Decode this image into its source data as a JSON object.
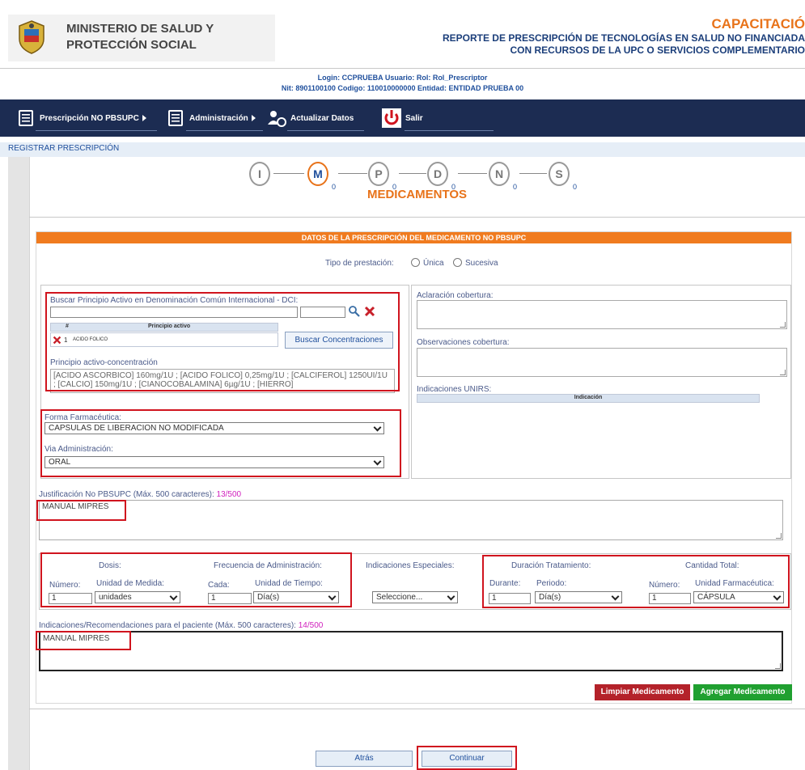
{
  "header": {
    "ministry_line1": "MINISTERIO DE SALUD Y",
    "ministry_line2": "PROTECCIÓN SOCIAL",
    "capacitacion": "CAPACITACIÓ",
    "report_line1": "REPORTE DE PRESCRIPCIÓN DE TECNOLOGÍAS EN SALUD NO FINANCIADA",
    "report_line2": "CON RECURSOS DE LA UPC O SERVICIOS COMPLEMENTARIO",
    "login_line1": "Login: CCPRUEBA Usuario: Rol: Rol_Prescriptor",
    "login_line2": "Nit: 8901100100 Codigo: 110010000000 Entidad: ENTIDAD PRUEBA 00"
  },
  "nav": {
    "items": [
      {
        "label": "Prescripción NO PBSUPC"
      },
      {
        "label": "Administración"
      },
      {
        "label": "Actualizar Datos"
      },
      {
        "label": "Salir"
      }
    ]
  },
  "section_title": "REGISTRAR PRESCRIPCIÓN",
  "steps": [
    {
      "letter": "I",
      "count": ""
    },
    {
      "letter": "M",
      "count": "0"
    },
    {
      "letter": "P",
      "count": "0"
    },
    {
      "letter": "D",
      "count": "0"
    },
    {
      "letter": "N",
      "count": "0"
    },
    {
      "letter": "S",
      "count": "0"
    }
  ],
  "step_title": "MEDICAMENTOS",
  "form": {
    "bar_title": "DATOS DE LA PRESCRIPCIÓN DEL MEDICAMENTO NO PBSUPC",
    "tipo_prestacion_label": "Tipo de prestación:",
    "tipo_unica": "Única",
    "tipo_sucesiva": "Sucesiva",
    "buscar_label": "Buscar Principio Activo en Denominación Común Internacional - DCI:",
    "table_hash": "#",
    "table_principio": "Principio activo",
    "row_num": "1",
    "row_value": "ACIDO FOLICO",
    "buscar_conc_btn": "Buscar Concentraciones",
    "principio_conc_label": "Principio activo-concentración",
    "principio_conc_value": "[ACIDO ASCORBICO] 160mg/1U ; [ACIDO FOLICO] 0,25mg/1U ; [CALCIFEROL] 1250UI/1U ; [CALCIO] 150mg/1U ; [CIANOCOBALAMINA] 6µg/1U ; [HIERRO]",
    "aclaracion_label": "Aclaración cobertura:",
    "observaciones_label": "Observaciones cobertura:",
    "indicaciones_unirs_label": "Indicaciones UNIRS:",
    "indicacion_col": "Indicación",
    "forma_label": "Forma Farmacéutica:",
    "forma_value": "CAPSULAS DE LIBERACION NO MODIFICADA",
    "via_label": "Via Administración:",
    "via_value": "ORAL",
    "justificacion_label": "Justificación No PBSUPC (Máx. 500 caracteres):",
    "justificacion_count": "13/500",
    "justificacion_value": "MANUAL MIPRES",
    "dosis_title": "Dosis:",
    "numero_label": "Número:",
    "numero_value": "1",
    "unidad_medida_label": "Unidad de Medida:",
    "unidad_medida_value": "unidades",
    "frecuencia_title": "Frecuencia de Administración:",
    "cada_label": "Cada:",
    "cada_value": "1",
    "unidad_tiempo_label": "Unidad de Tiempo:",
    "unidad_tiempo_value": "Día(s)",
    "indic_esp_title": "Indicaciones Especiales:",
    "indic_esp_value": "Seleccione...",
    "duracion_title": "Duración Tratamiento:",
    "durante_label": "Durante:",
    "durante_value": "1",
    "periodo_label": "Periodo:",
    "periodo_value": "Día(s)",
    "cantidad_title": "Cantidad Total:",
    "cant_numero_label": "Número:",
    "cant_numero_value": "1",
    "unidad_farm_label": "Unidad Farmacéutica:",
    "unidad_farm_value": "CÁPSULA",
    "recomendaciones_label": "Indicaciones/Recomendaciones para el paciente (Máx. 500 caracteres):",
    "recomendaciones_count": "14/500",
    "recomendaciones_value": "MANUAL MIPRES",
    "limpiar_btn": "Limpiar Medicamento",
    "agregar_btn": "Agregar Medicamento"
  },
  "footer": {
    "atras_btn": "Atrás",
    "continuar_btn": "Continuar"
  },
  "colors": {
    "nav_bg": "#1c2c52",
    "orange": "#f07b1f",
    "highlight_red": "#d0141e",
    "limpiar": "#b4222a",
    "agregar": "#20a030"
  }
}
